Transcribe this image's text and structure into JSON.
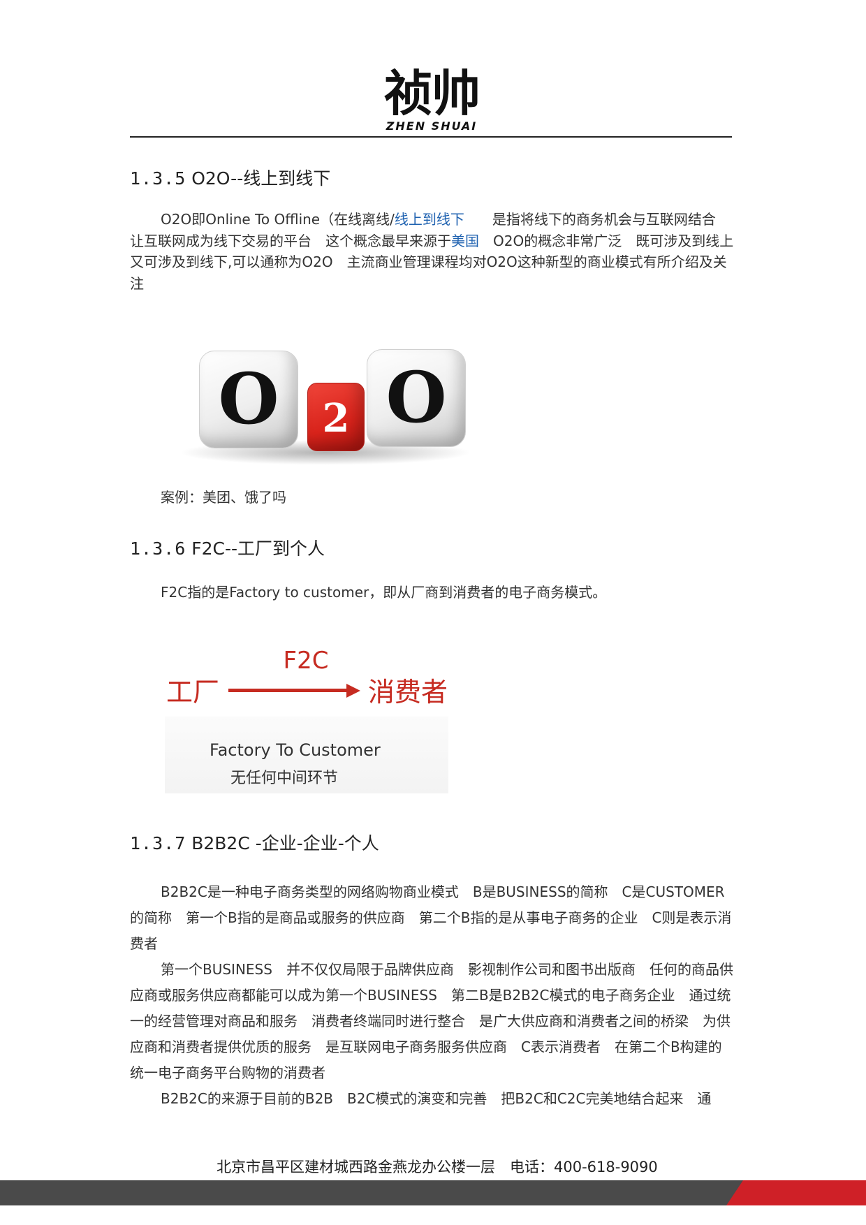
{
  "header": {
    "logo_cn": "祯帅",
    "logo_en": "ZHEN SHUAI"
  },
  "sections": [
    {
      "num": "1.3.5",
      "title": "O2O--线上到线下",
      "para_pre": "O2O即Online To Offline（在线离线/",
      "para_link1": "线上到线下",
      "para_mid1": "　　是指将线下的商务机会与互联网结合　让互联网成为线下交易的平台　这个概念最早来源于",
      "para_link2": "美国",
      "para_post": "　O2O的概念非常广泛　既可涉及到线上　又可涉及到线下,可以通称为O2O　主流商业管理课程均对O2O这种新型的商业模式有所介绍及关注",
      "case": "案例：美团、饿了吗"
    },
    {
      "num": "1.3.6",
      "title": "F2C--工厂到个人",
      "definition": "F2C指的是Factory to customer，即从厂商到消费者的电子商务模式。"
    },
    {
      "num": "1.3.7",
      "title": "B2B2C -企业-企业-个人",
      "paragraphs": [
        "B2B2C是一种电子商务类型的网络购物商业模式　B是BUSINESS的简称　C是CUSTOMER的简称　第一个B指的是商品或服务的供应商　第二个B指的是从事电子商务的企业　C则是表示消费者",
        "第一个BUSINESS　并不仅仅局限于品牌供应商　影视制作公司和图书出版商　任何的商品供应商或服务供应商都能可以成为第一个BUSINESS　第二B是B2B2C模式的电子商务企业　通过统一的经营管理对商品和服务　消费者终端同时进行整合　是广大供应商和消费者之间的桥梁　为供应商和消费者提供优质的服务　是互联网电子商务服务供应商　C表示消费者　在第二个B构建的统一电子商务平台购物的消费者",
        "B2B2C的来源于目前的B2B　B2C模式的演变和完善　把B2C和C2C完美地结合起来　通"
      ]
    }
  ],
  "o2o_image": {
    "left_char": "O",
    "middle_char": "2",
    "right_char": "O"
  },
  "f2c_image": {
    "left": "工厂",
    "label": "F2C",
    "right": "消费者",
    "caption_en": "Factory To Customer",
    "caption_cn": "无任何中间环节"
  },
  "footer": {
    "text": "北京市昌平区建材城西路金燕龙办公楼一层　电话：400-618-9090",
    "bar_dark_color": "#4a4a4a",
    "bar_accent_color": "#cf2027"
  }
}
